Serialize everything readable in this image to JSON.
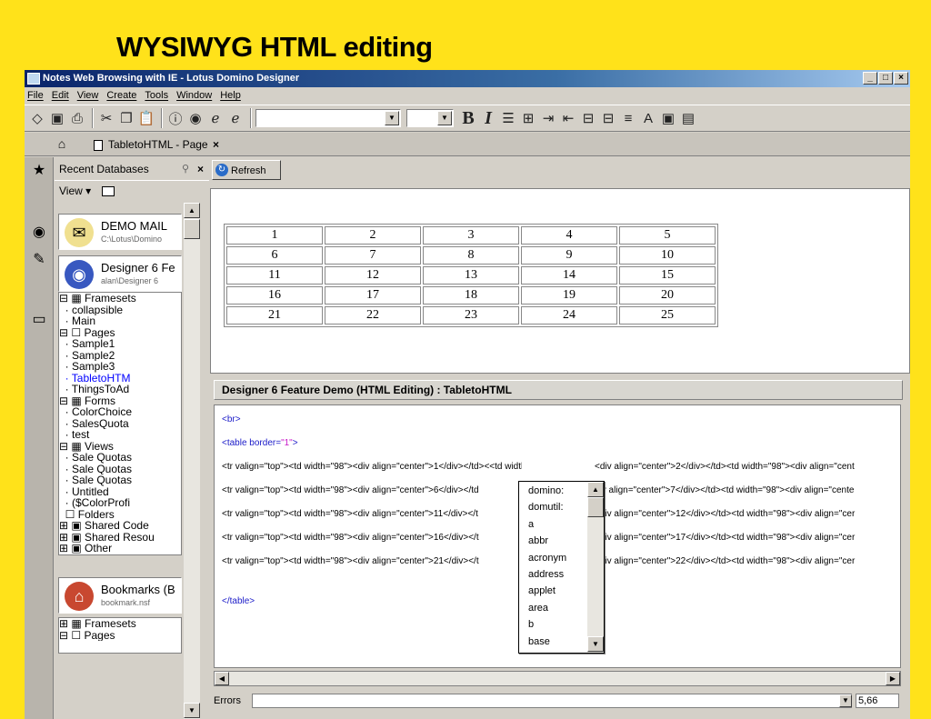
{
  "slide": {
    "title": "WYSIWYG HTML editing"
  },
  "window": {
    "title": "Notes Web Browsing with IE - Lotus Domino Designer",
    "buttons": {
      "minimize": "_",
      "maximize": "□",
      "close": "×"
    }
  },
  "menu": [
    "File",
    "Edit",
    "View",
    "Create",
    "Tools",
    "Window",
    "Help"
  ],
  "toolbar": {
    "bold": "B",
    "italic": "I"
  },
  "tabs": {
    "doc_tab_label": "TabletoHTML - Page",
    "close": "×"
  },
  "nav": {
    "header": "Recent Databases",
    "close": "×",
    "view_label": "View ▾",
    "databases": [
      {
        "name": "DEMO MAIL",
        "path": "C:\\Lotus\\Domino"
      },
      {
        "name": "Designer 6 Fe",
        "path": "alan\\Designer 6"
      },
      {
        "name": "Bookmarks (B",
        "path": "bookmark.nsf"
      }
    ],
    "tree": [
      "⊟ ▦ Framesets",
      "  · collapsible",
      "  · Main",
      "⊟ ☐ Pages",
      "  · Sample1",
      "  · Sample2",
      "  · Sample3",
      "  · TabletoHTM",
      "  · ThingsToAd",
      "⊟ ▦ Forms",
      "  · ColorChoice",
      "  · SalesQuota",
      "  · test",
      "⊟ ▦ Views",
      "  · Sale Quotas",
      "  · Sale Quotas",
      "  · Sale Quotas",
      "  · Untitled",
      "  · ($ColorProfi",
      "  ☐ Folders",
      "⊞ ▣ Shared Code",
      "⊞ ▣ Shared Resou",
      "⊞ ▣ Other"
    ],
    "selected_index": 7,
    "tree2": [
      "⊞ ▦ Framesets",
      "⊟ ☐ Pages"
    ]
  },
  "main": {
    "refresh": "Refresh",
    "table": [
      [
        "1",
        "2",
        "3",
        "4",
        "5"
      ],
      [
        "6",
        "7",
        "8",
        "9",
        "10"
      ],
      [
        "11",
        "12",
        "13",
        "14",
        "15"
      ],
      [
        "16",
        "17",
        "18",
        "19",
        "20"
      ],
      [
        "21",
        "22",
        "23",
        "24",
        "25"
      ]
    ],
    "source_title": "Designer 6 Feature Demo (HTML Editing) : TabletoHTML",
    "source": {
      "br": "<br>",
      "table_open_a": "<table border=",
      "table_open_b": "\"1\"",
      "table_open_c": ">",
      "close": "</table>",
      "rows": [
        {
          "left": "<tr valign=\"top\"><td width=\"98\"><div align=\"center\">1</div></td><<td width=\"98\">",
          "right": "<div align=\"center\">2</div></td><td width=\"98\"><div align=\"cent"
        },
        {
          "left": "<tr valign=\"top\"><td width=\"98\"><div align=\"center\">6</div></td",
          "right": "div align=\"center\">7</div></td><td width=\"98\"><div align=\"cente"
        },
        {
          "left": "<tr valign=\"top\"><td width=\"98\"><div align=\"center\">11</div></t",
          "right": "<div align=\"center\">12</div></td><td width=\"98\"><div align=\"cer"
        },
        {
          "left": "<tr valign=\"top\"><td width=\"98\"><div align=\"center\">16</div></t",
          "right": "<div align=\"center\">17</div></td><td width=\"98\"><div align=\"cer"
        },
        {
          "left": "<tr valign=\"top\"><td width=\"98\"><div align=\"center\">21</div></t",
          "right": "<div align=\"center\">22</div></td><td width=\"98\"><div align=\"cer"
        }
      ]
    },
    "autocomplete": [
      "domino:",
      "domutil:",
      "a",
      "abbr",
      "acronym",
      "address",
      "applet",
      "area",
      "b",
      "base"
    ],
    "errors_label": "Errors",
    "position": "5,66"
  }
}
